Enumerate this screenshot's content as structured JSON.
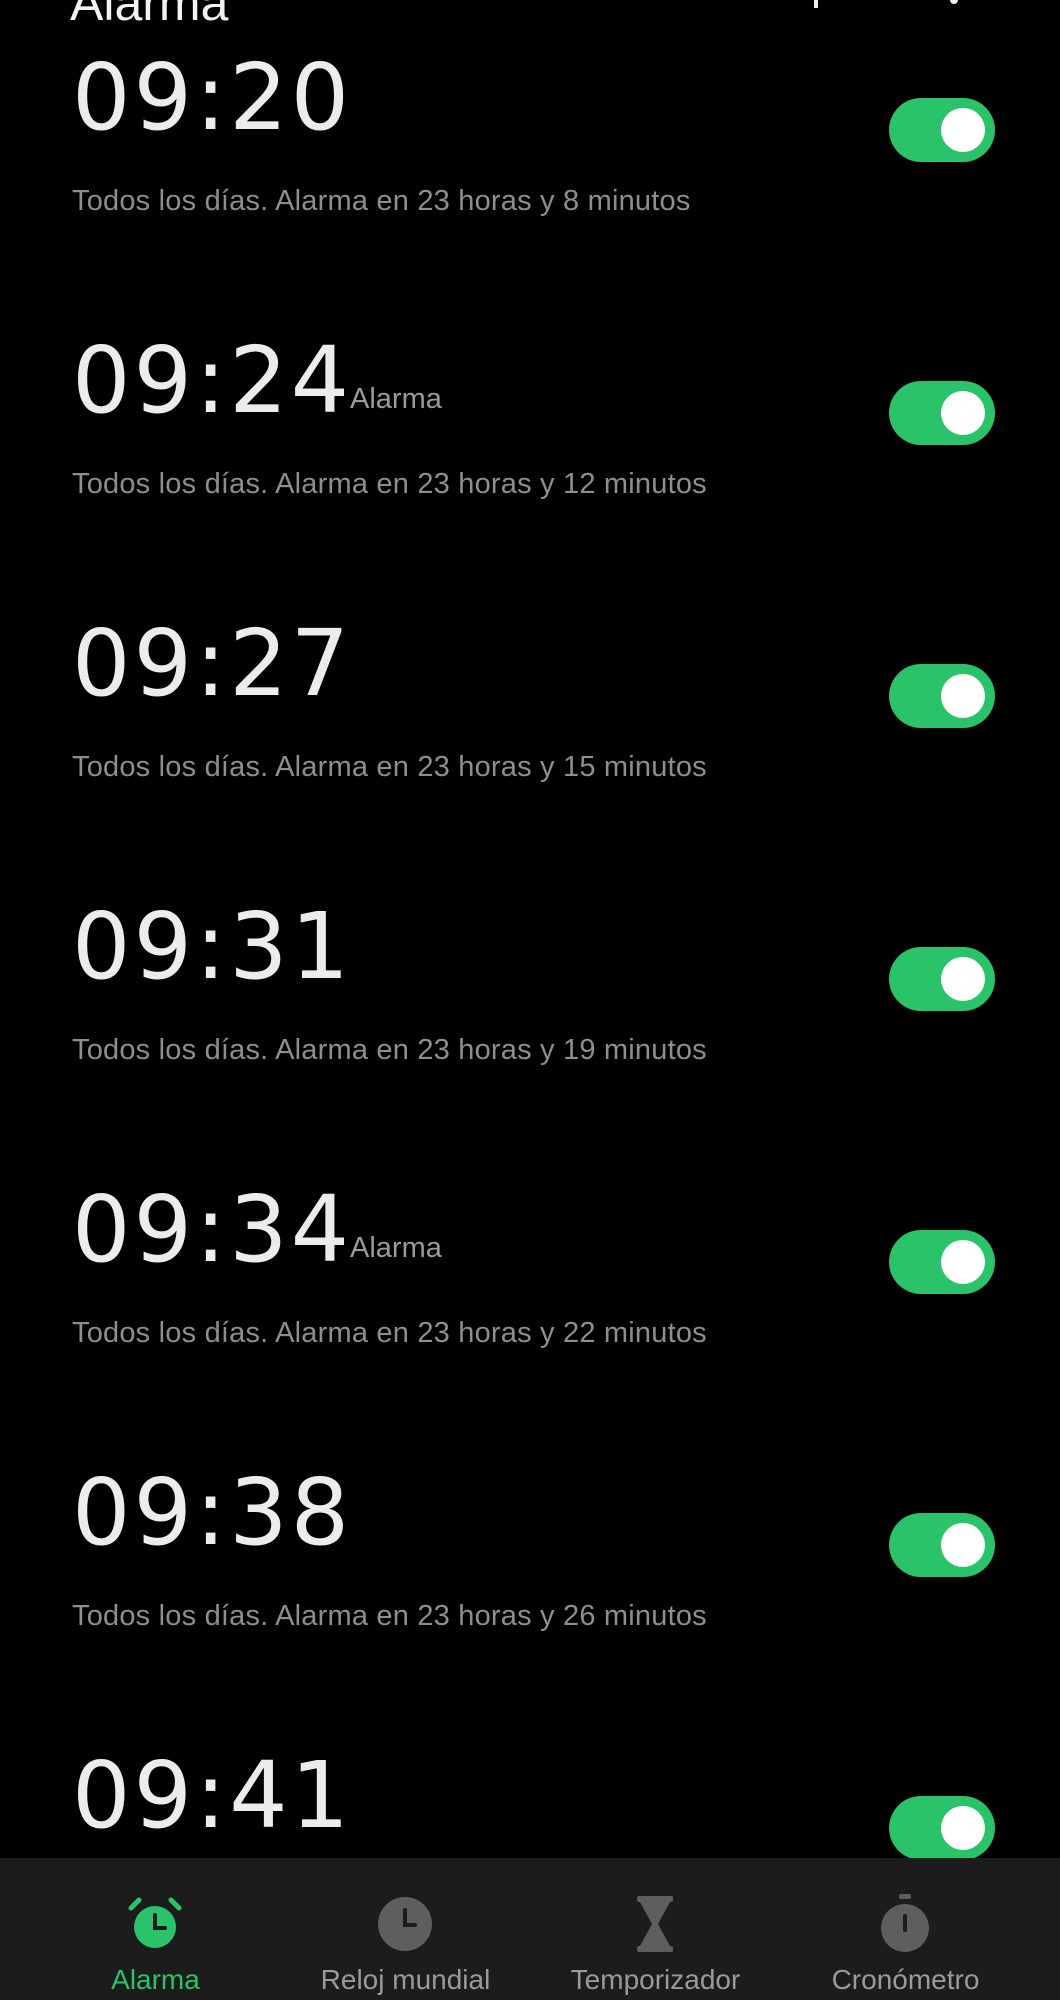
{
  "header": {
    "title": "Alarma"
  },
  "alarms": [
    {
      "time": "09:20",
      "label": "",
      "subtitle": "Todos los días. Alarma en 23 horas y 8 minutos",
      "enabled": true
    },
    {
      "time": "09:24",
      "label": "Alarma",
      "subtitle": "Todos los días. Alarma en 23 horas y 12 minutos",
      "enabled": true
    },
    {
      "time": "09:27",
      "label": "",
      "subtitle": "Todos los días. Alarma en 23 horas y 15 minutos",
      "enabled": true
    },
    {
      "time": "09:31",
      "label": "",
      "subtitle": "Todos los días. Alarma en 23 horas y 19 minutos",
      "enabled": true
    },
    {
      "time": "09:34",
      "label": "Alarma",
      "subtitle": "Todos los días. Alarma en 23 horas y 22 minutos",
      "enabled": true
    },
    {
      "time": "09:38",
      "label": "",
      "subtitle": "Todos los días. Alarma en 23 horas y 26 minutos",
      "enabled": true
    },
    {
      "time": "09:41",
      "label": "",
      "subtitle": "",
      "enabled": true
    }
  ],
  "bottom_nav": {
    "items": [
      {
        "label": "Alarma",
        "icon": "alarm-clock-icon",
        "active": true
      },
      {
        "label": "Reloj mundial",
        "icon": "clock-icon",
        "active": false
      },
      {
        "label": "Temporizador",
        "icon": "hourglass-icon",
        "active": false
      },
      {
        "label": "Cronómetro",
        "icon": "stopwatch-icon",
        "active": false
      }
    ]
  },
  "colors": {
    "accent": "#2ac369",
    "background": "#000000",
    "nav_background": "#1c1c1c",
    "inactive_icon": "#5e5e5e"
  }
}
